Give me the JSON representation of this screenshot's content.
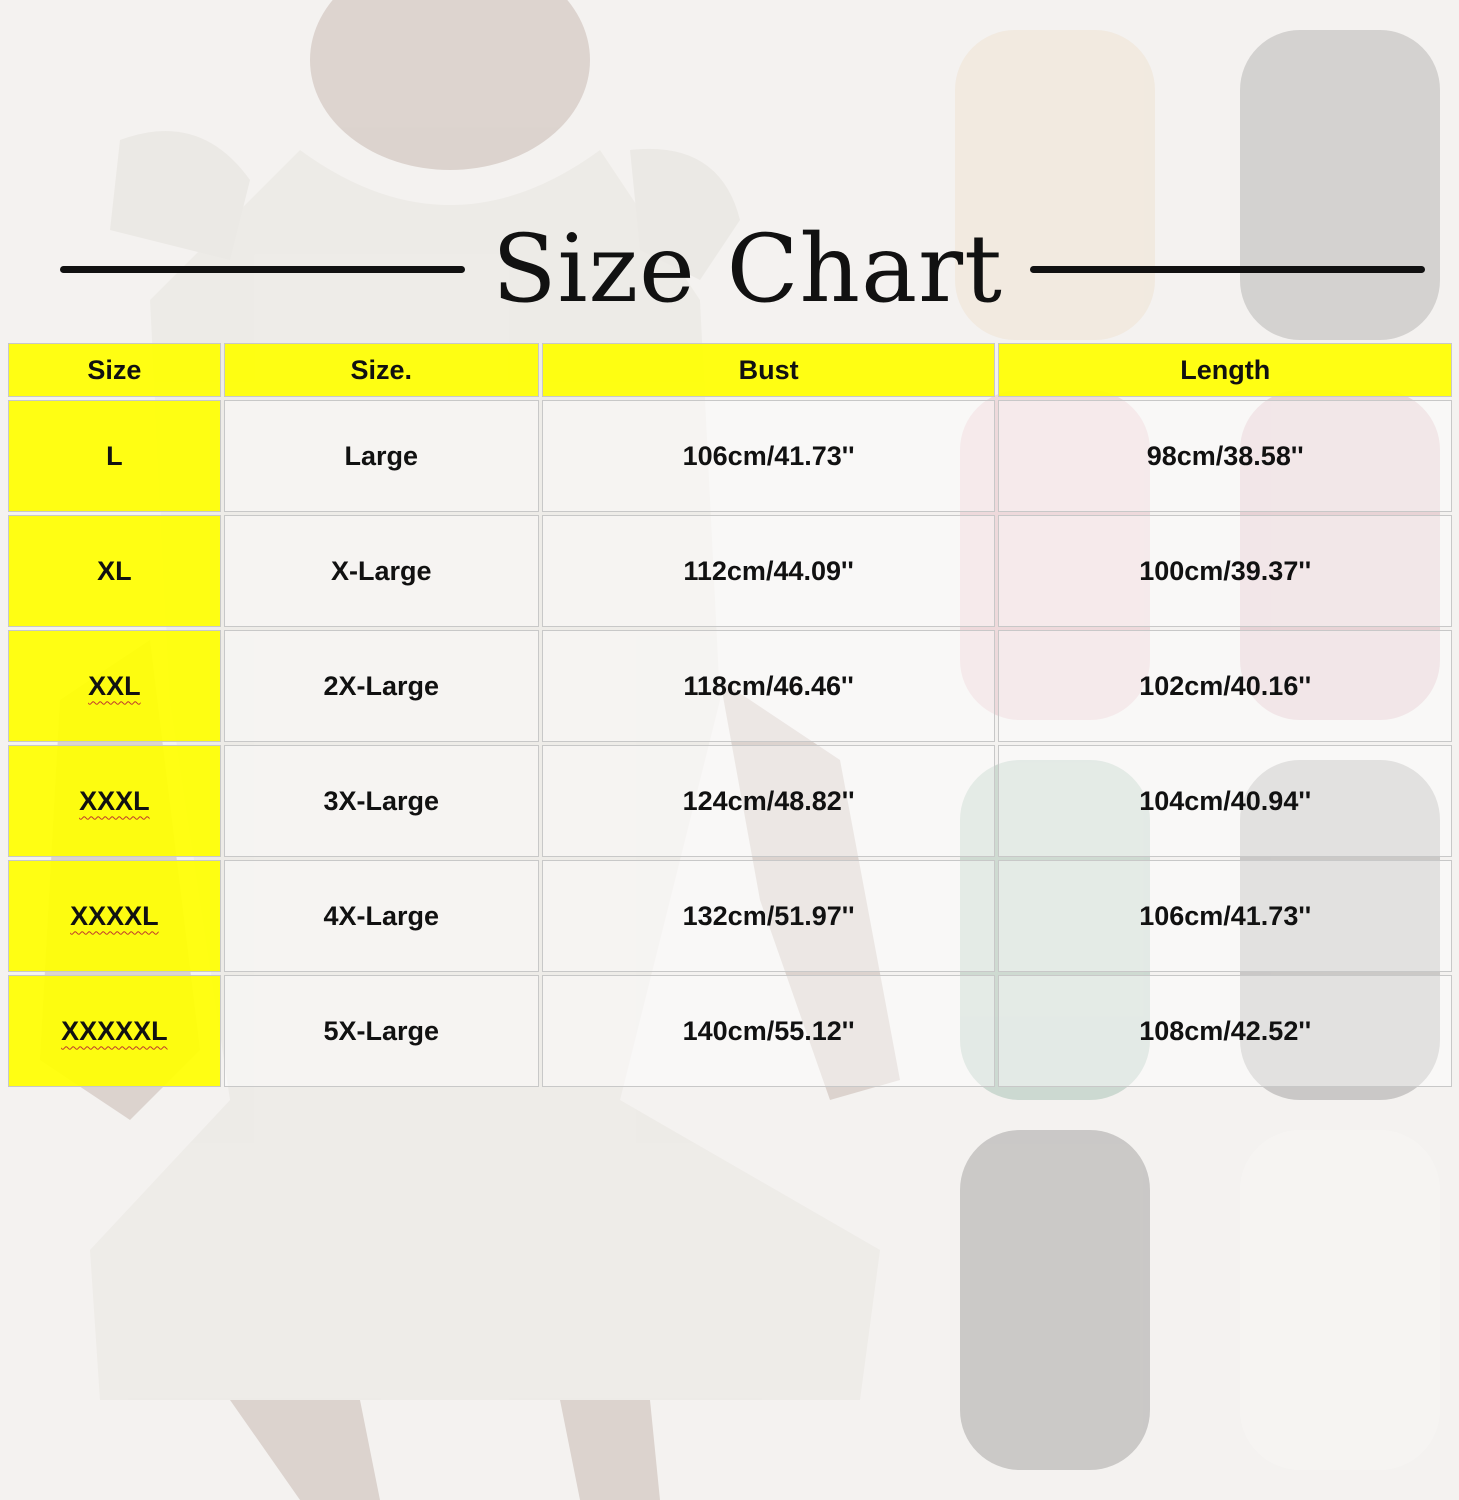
{
  "title": "Size Chart",
  "colors": {
    "header_bg": "#ffff00",
    "size_col_bg": "#ffff00",
    "text": "#111111"
  },
  "table": {
    "headers": [
      "Size",
      "Size.",
      "Bust",
      "Length"
    ],
    "rows": [
      {
        "size": "L",
        "size_name": "Large",
        "bust": "106cm/41.73''",
        "length": "98cm/38.58''"
      },
      {
        "size": "XL",
        "size_name": "X-Large",
        "bust": "112cm/44.09''",
        "length": "100cm/39.37''"
      },
      {
        "size": "XXL",
        "size_name": "2X-Large",
        "bust": "118cm/46.46''",
        "length": "102cm/40.16''"
      },
      {
        "size": "XXXL",
        "size_name": "3X-Large",
        "bust": "124cm/48.82''",
        "length": "104cm/40.94''"
      },
      {
        "size": "XXXXL",
        "size_name": "4X-Large",
        "bust": "132cm/51.97''",
        "length": "106cm/41.73''"
      },
      {
        "size": "XXXXXL",
        "size_name": "5X-Large",
        "bust": "140cm/55.12''",
        "length": "108cm/42.52''"
      }
    ]
  }
}
